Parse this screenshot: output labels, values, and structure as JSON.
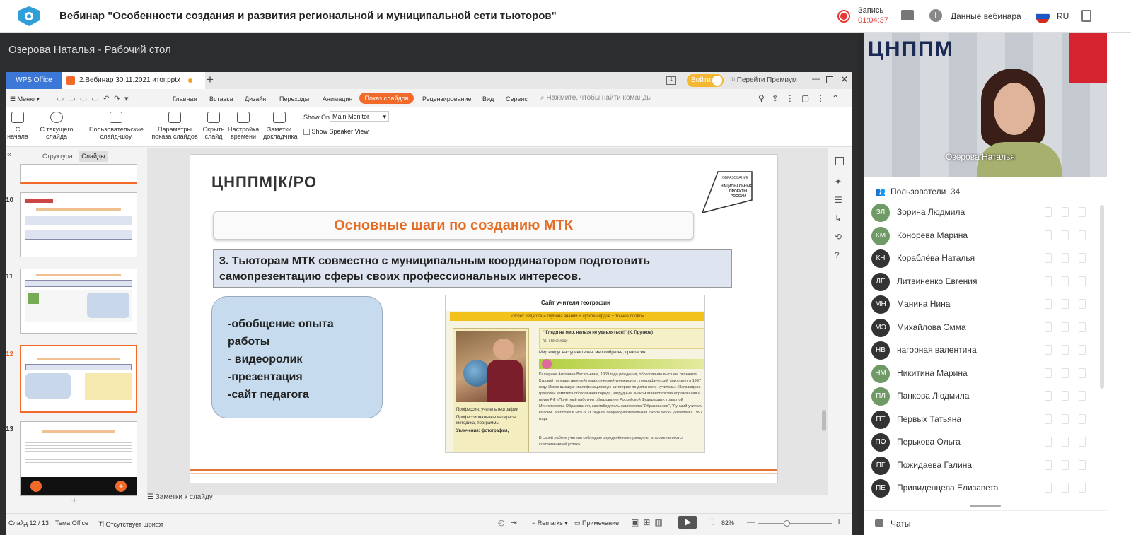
{
  "app": {
    "title": "Вебинар \"Особенности создания и развития региональной и муниципальной сети тьюторов\"",
    "record_label": "Запись",
    "record_time": "01:04:37",
    "webinar_data": "Данные вебинара",
    "lang": "RU"
  },
  "desktop": {
    "title": "Озерова Наталья - Рабочий стол"
  },
  "wps": {
    "tab_app": "WPS Office",
    "tab_file": "2.Вебинар 30.11.2021 итог.pptx",
    "login": "Войти",
    "premium": "Перейти Премиум",
    "menu": [
      "Меню",
      "Главная",
      "Вставка",
      "Дизайн",
      "Переходы",
      "Анимация",
      "Показ слайдов",
      "Рецензирование",
      "Вид",
      "Сервис"
    ],
    "search_placeholder": "Нажмите, чтобы найти команды",
    "ribbon": [
      {
        "label": "С начала"
      },
      {
        "label": "С текущего слайда"
      },
      {
        "label": "Пользовательские слайд-шоу"
      },
      {
        "label": "Параметры показа слайдов"
      },
      {
        "label": "Скрыть слайд"
      },
      {
        "label": "Настройка времени"
      },
      {
        "label": "Заметки докладчика"
      }
    ],
    "show_on": "Show On:",
    "monitor": "Main Monitor",
    "speaker_view": "Show Speaker View",
    "panel_tabs": [
      "Структура",
      "Слайды"
    ],
    "thumb_numbers": [
      "10",
      "11",
      "12",
      "13"
    ],
    "notes_placeholder": "Заметки к слайду",
    "status": {
      "slide": "Слайд 12 / 13",
      "theme": "Тема Office",
      "font_missing": "Отсутствует шрифт",
      "remarks": "Remarks",
      "comment": "Примечание",
      "zoom": "82%"
    }
  },
  "slide": {
    "logo": "ЦНППМ|К/РО",
    "badge": "ОБРАЗОВАНИЕ НАЦИОНАЛЬНЫЕ ПРОЕКТЫ РОССИИ",
    "heading": "Основные шаги по созданию МТК",
    "step": "3. Тьюторам МТК совместно с муниципальным координатором подготовить самопрезентацию сферы своих профессиональных интересов.",
    "bullets": [
      "-обобщение опыта работы",
      "- видеоролик",
      "-презентация",
      "-сайт педагога"
    ],
    "site_title": "Сайт учителя географии",
    "site_motto": "«Успех педагога = глубина знаний + чуткое сердце + точное слово»",
    "site_quote": "\" Глядя на мир, нельзя не удивляться!\" (К. Прутков)",
    "site_quote_author": "(К. Прутков)",
    "site_intro": "Мир вокруг нас удивителен, многообразен, прекрасен...",
    "site_profession": "Профессия: учитель географии",
    "site_interests": "Профессиональные интересы: методика, программы",
    "site_hobby": "Увлечения: фотография,",
    "site_text": "Калырина Антонина Васильевна, 1969 года рождения, образование высшее, окончила Курский государственный педагогический университет, географический факультет в 1997 году. Имею высшую квалификационную категорию по должности «учитель». Награждена грамотой комитета образования города, нагрудным знаком Министерства образования и науки РФ «Почётный работник образования Российской Федерации», грамотой Министерства Образования, как победитель нацпроекта \"Образование\", \"Лучший учитель России\". Работаю в МБОУ «Средняя общеобразовательная школа №59» учителем с 1997 года.",
    "site_text2": "В своей работе учитель соблюдаю определённые принципы, которые являются слагаемыми её успеха."
  },
  "video": {
    "speaker": "Озерова Наталья",
    "bg_text": "ЦНППМ"
  },
  "users": {
    "label": "Пользователи",
    "count": "34",
    "list": [
      {
        "initials": "ЗЛ",
        "name": "Зорина Людмила"
      },
      {
        "initials": "КМ",
        "name": "Конорева Марина"
      },
      {
        "initials": "КН",
        "name": "Кораблёва Наталья"
      },
      {
        "initials": "ЛЕ",
        "name": "Литвиненко Евгения"
      },
      {
        "initials": "МН",
        "name": "Манина Нина"
      },
      {
        "initials": "МЭ",
        "name": "Михайлова Эмма"
      },
      {
        "initials": "НВ",
        "name": "нагорная валентина"
      },
      {
        "initials": "НМ",
        "name": "Никитина Марина"
      },
      {
        "initials": "ПЛ",
        "name": "Панкова Людмила"
      },
      {
        "initials": "ПТ",
        "name": "Первых Татьяна"
      },
      {
        "initials": "ПО",
        "name": "Перькова Ольга"
      },
      {
        "initials": "ПГ",
        "name": "Пожидаева Галина"
      },
      {
        "initials": "ПЕ",
        "name": "Привиденцева Елизавета"
      }
    ],
    "chats_label": "Чаты"
  },
  "colors": {
    "accent": "#f26a2a",
    "avatar_dark": "#333333",
    "avatar_green": "#6f9a65",
    "wps_blue": "#3c78d8"
  }
}
